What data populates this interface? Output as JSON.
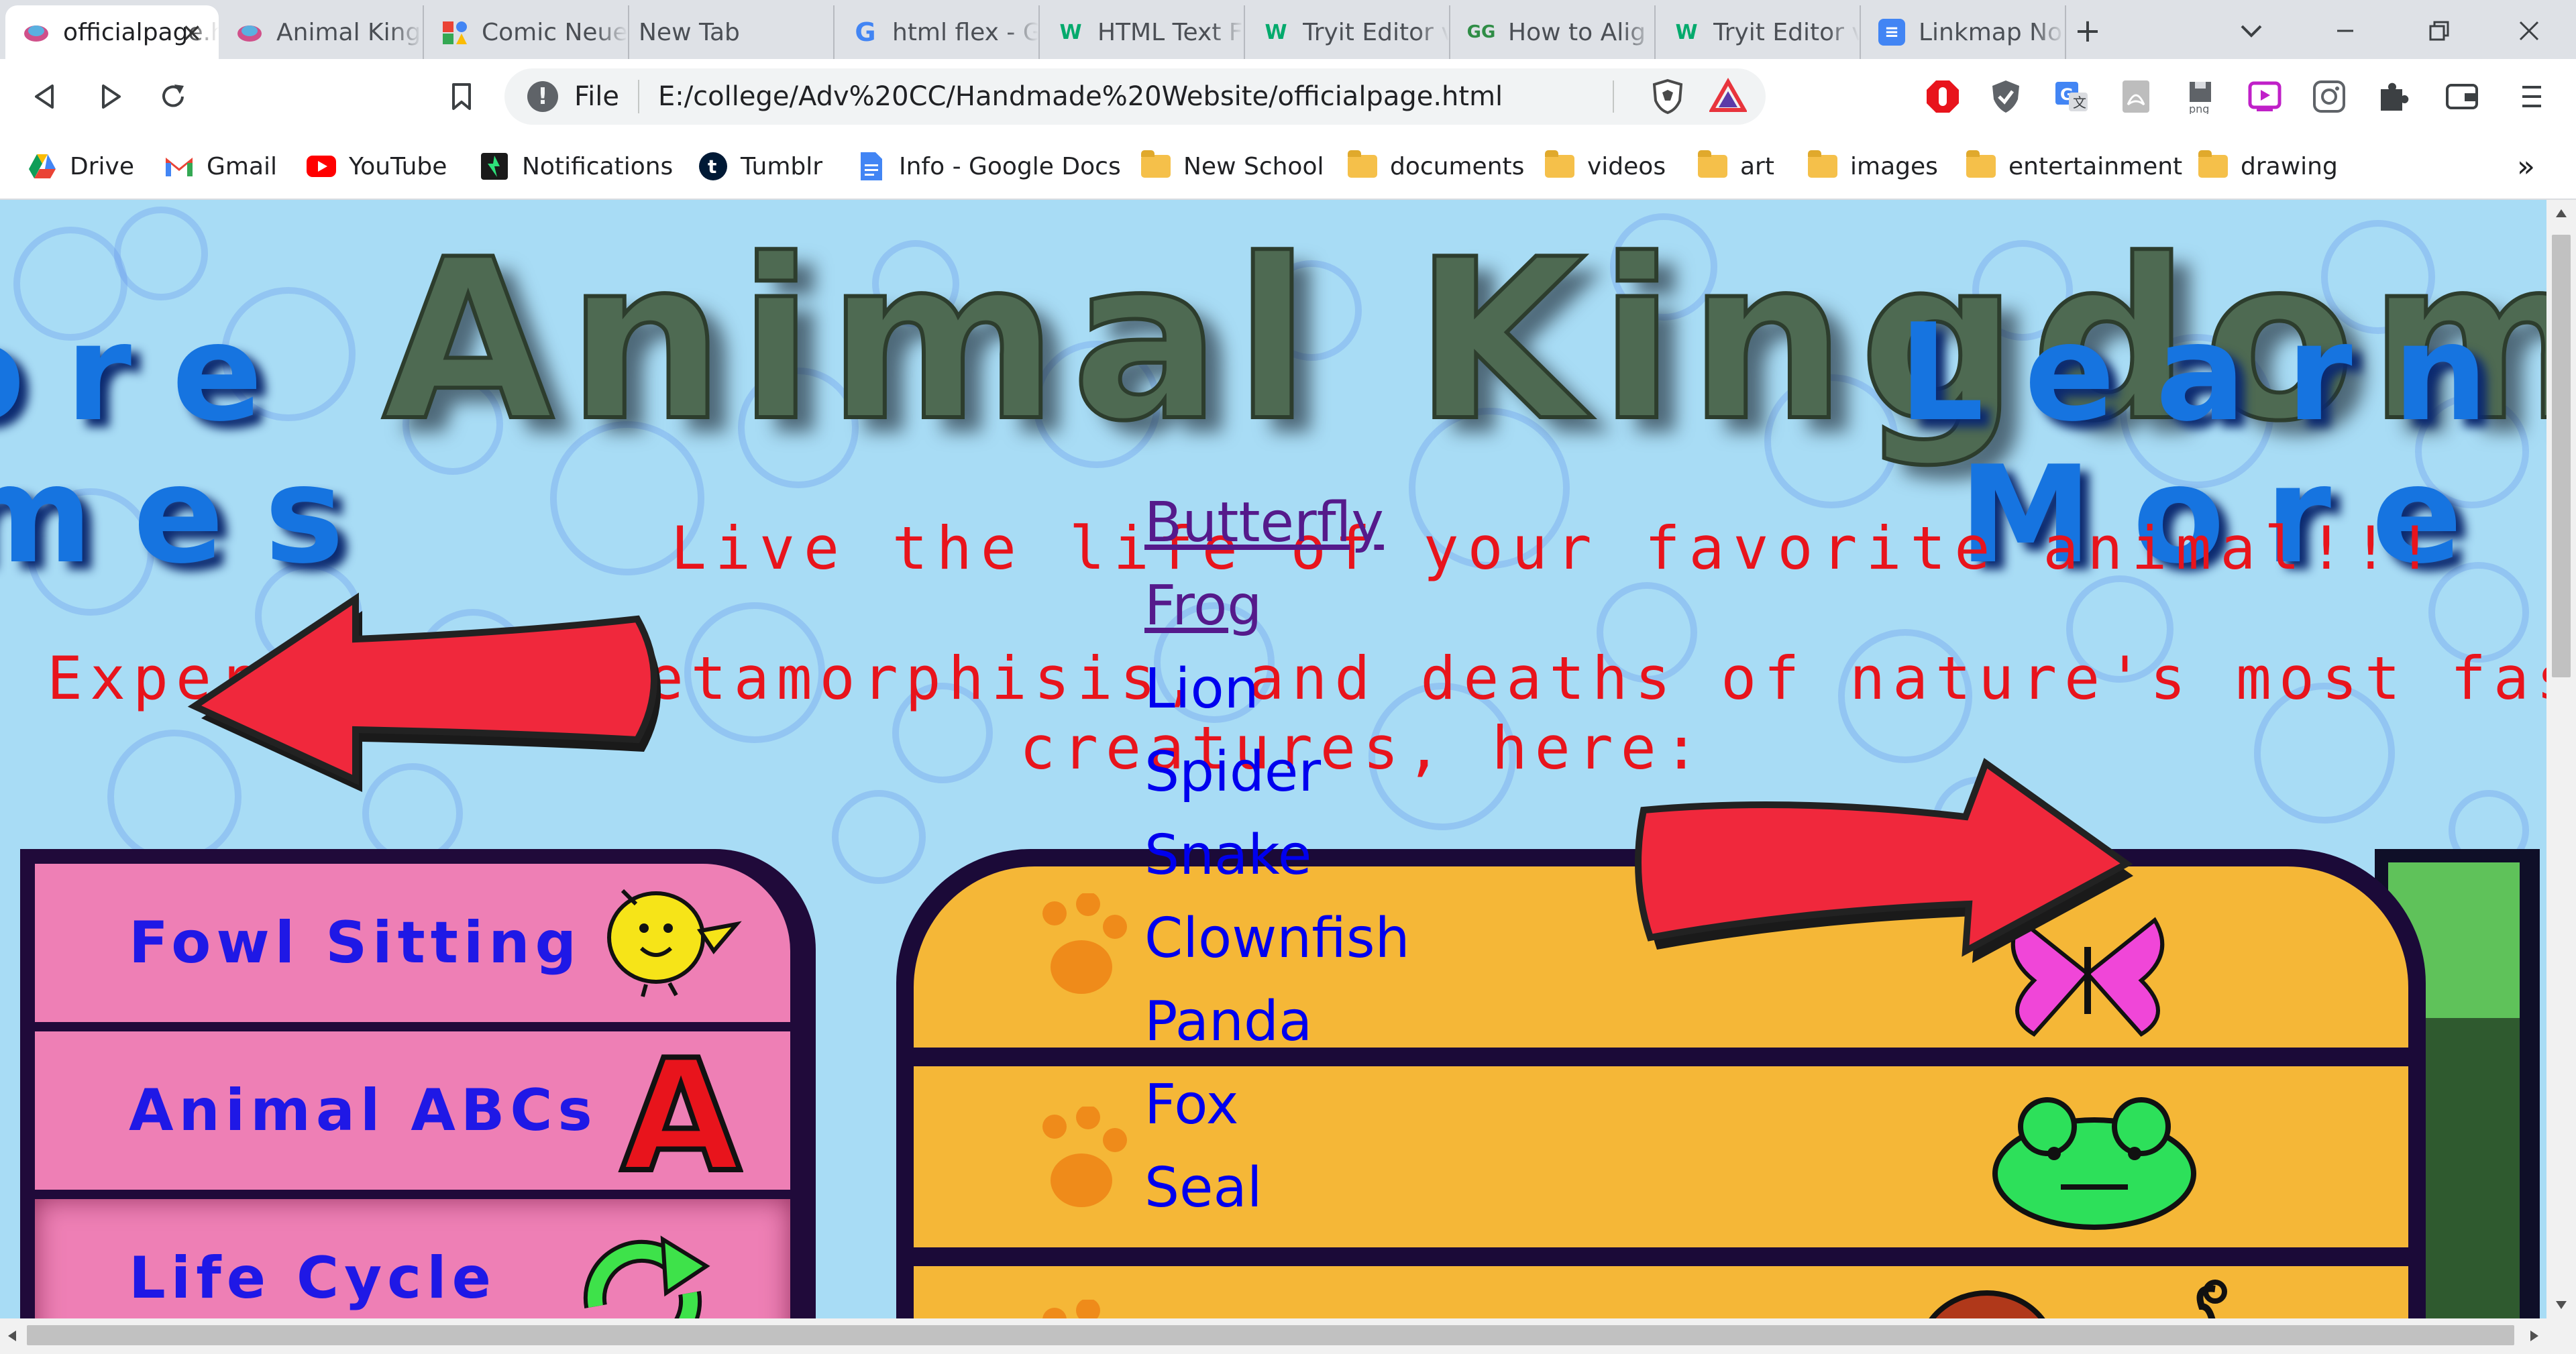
{
  "browser": {
    "tabs": [
      {
        "title": "officialpage.html",
        "active": true
      },
      {
        "title": "Animal Kingdom"
      },
      {
        "title": "Comic Neue"
      },
      {
        "title": "New Tab"
      },
      {
        "title": "html flex - G"
      },
      {
        "title": "HTML Text F"
      },
      {
        "title": "Tryit Editor v"
      },
      {
        "title": "How to Alig"
      },
      {
        "title": "Tryit Editor v"
      },
      {
        "title": "Linkmap No"
      }
    ],
    "new_tab_symbol": "+",
    "address_scheme": "File",
    "address_url": "E:/college/Adv%20CC/Handmade%20Website/officialpage.html",
    "bookmarks": [
      {
        "label": "Drive",
        "icon": "drive-icon"
      },
      {
        "label": "Gmail",
        "icon": "gmail-icon"
      },
      {
        "label": "YouTube",
        "icon": "youtube-icon"
      },
      {
        "label": "Notifications",
        "icon": "notifications-icon"
      },
      {
        "label": "Tumblr",
        "icon": "tumblr-icon"
      },
      {
        "label": "Info - Google Docs",
        "icon": "docs-icon"
      },
      {
        "label": "New School",
        "icon": "folder-icon"
      },
      {
        "label": "documents",
        "icon": "folder-icon"
      },
      {
        "label": "videos",
        "icon": "folder-icon"
      },
      {
        "label": "art",
        "icon": "folder-icon"
      },
      {
        "label": "images",
        "icon": "folder-icon"
      },
      {
        "label": "entertainment",
        "icon": "folder-icon"
      },
      {
        "label": "drawing",
        "icon": "folder-icon"
      }
    ],
    "bookmarks_overflow": "»"
  },
  "page": {
    "title": "Animal Kingdom",
    "left_banner": {
      "line1": "ore",
      "line2": "mes"
    },
    "right_banner": {
      "line1": "Learn",
      "line2": "More"
    },
    "tagline": "Live the life of your favorite animal!!!",
    "description_line1": "Experiences, metamorphisis, and deaths of nature's most fascinating",
    "description_line2": "creatures, here:",
    "left_menu": [
      {
        "label": "Fowl Sitting",
        "icon": "chick-icon"
      },
      {
        "label": "Animal ABCs",
        "icon": "letter-a-icon"
      },
      {
        "label": "Life Cycle",
        "icon": "cycle-arrows-icon"
      }
    ],
    "left_menu_letter": "A",
    "animals": [
      {
        "name": "Butterfly",
        "visited": true
      },
      {
        "name": "Frog",
        "visited": true
      },
      {
        "name": "Lion",
        "visited": false
      },
      {
        "name": "Spider",
        "visited": false
      },
      {
        "name": "Snake",
        "visited": false
      },
      {
        "name": "Clownfish",
        "visited": false
      },
      {
        "name": "Panda",
        "visited": false
      },
      {
        "name": "Fox",
        "visited": false
      },
      {
        "name": "Seal",
        "visited": false
      }
    ],
    "colors": {
      "sky": "#a8dcf5",
      "title_blue": "#1674e0",
      "red_text": "#e8141c",
      "menu_pink": "#ee7fb5",
      "panel_orange": "#f5b737",
      "link_blue": "#0000ee",
      "link_visited": "#551a8b"
    }
  }
}
